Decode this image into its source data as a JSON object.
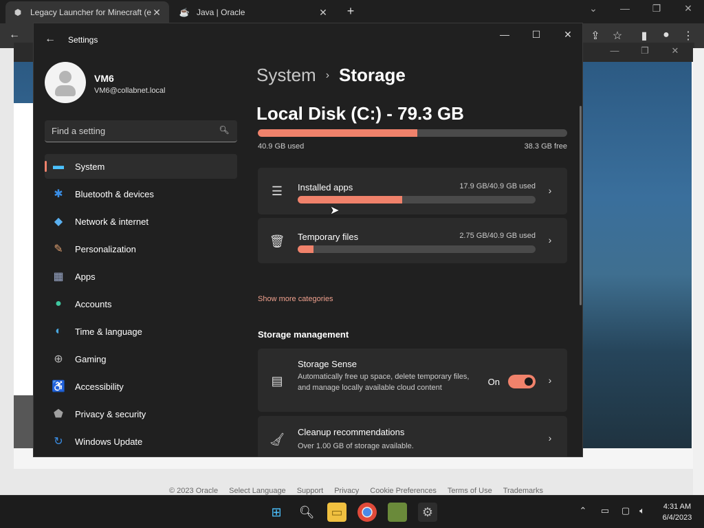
{
  "browser": {
    "tabs": [
      {
        "title": "Legacy Launcher for Minecraft (e",
        "icon": "shield-logo-icon"
      },
      {
        "title": "Java | Oracle",
        "icon": "java-logo-icon"
      }
    ],
    "footer_links": [
      "© 2023 Oracle",
      "Select Language",
      "Support",
      "Privacy",
      "Cookie Preferences",
      "Terms of Use",
      "Trademarks"
    ]
  },
  "settings": {
    "window_title": "Settings",
    "profile": {
      "name": "VM6",
      "email": "VM6@collabnet.local"
    },
    "search": {
      "placeholder": "Find a setting"
    },
    "nav": [
      {
        "label": "System",
        "icon": "monitor-icon",
        "color": "#4cc2ff",
        "active": true
      },
      {
        "label": "Bluetooth & devices",
        "icon": "bluetooth-icon",
        "color": "#3a8ee6",
        "active": false
      },
      {
        "label": "Network & internet",
        "icon": "wifi-icon",
        "color": "#5ab0f0",
        "active": false
      },
      {
        "label": "Personalization",
        "icon": "brush-icon",
        "color": "#e0a070",
        "active": false
      },
      {
        "label": "Apps",
        "icon": "apps-icon",
        "color": "#9aa8c8",
        "active": false
      },
      {
        "label": "Accounts",
        "icon": "person-icon",
        "color": "#3fc8a0",
        "active": false
      },
      {
        "label": "Time & language",
        "icon": "globe-clock-icon",
        "color": "#4aa8e0",
        "active": false
      },
      {
        "label": "Gaming",
        "icon": "gamepad-icon",
        "color": "#b8b8b8",
        "active": false
      },
      {
        "label": "Accessibility",
        "icon": "accessibility-icon",
        "color": "#3fa8f0",
        "active": false
      },
      {
        "label": "Privacy & security",
        "icon": "shield-icon",
        "color": "#a0a0a0",
        "active": false
      },
      {
        "label": "Windows Update",
        "icon": "update-icon",
        "color": "#3a8ee6",
        "active": false
      }
    ],
    "breadcrumb": {
      "parent": "System",
      "current": "Storage"
    },
    "disk": {
      "title": "Local Disk (C:) - 79.3 GB",
      "used_label": "40.9 GB used",
      "free_label": "38.3 GB free",
      "used_fraction": 0.516
    },
    "categories": [
      {
        "title": "Installed apps",
        "usage": "17.9 GB/40.9 GB used",
        "fraction": 0.438,
        "icon": "list-icon"
      },
      {
        "title": "Temporary files",
        "usage": "2.75 GB/40.9 GB used",
        "fraction": 0.067,
        "icon": "trash-icon"
      }
    ],
    "show_more": "Show more categories",
    "storage_management": {
      "title": "Storage management",
      "items": [
        {
          "title": "Storage Sense",
          "desc": "Automatically free up space, delete temporary files, and manage locally available cloud content",
          "toggle_label": "On",
          "icon": "drive-icon"
        },
        {
          "title": "Cleanup recommendations",
          "desc": "Over 1.00 GB of storage available.",
          "icon": "broom-icon"
        }
      ]
    },
    "accent": "#f0826b"
  },
  "taskbar": {
    "time": "4:31 AM",
    "date": "6/4/2023"
  }
}
